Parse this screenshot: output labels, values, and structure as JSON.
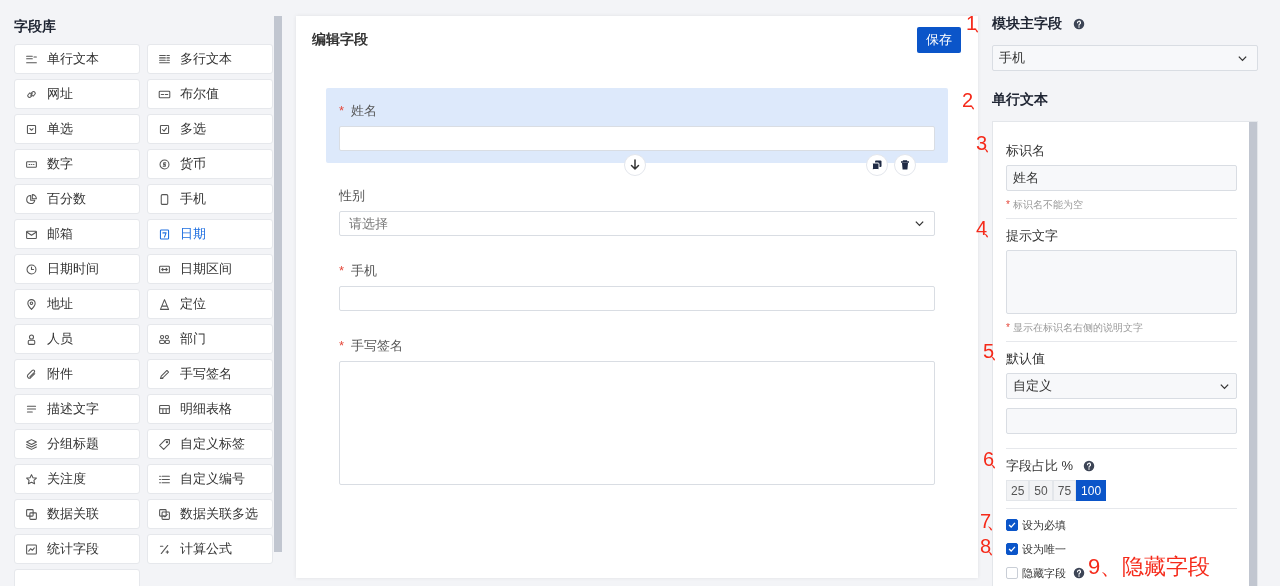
{
  "library": {
    "title": "字段库",
    "items": [
      {
        "label": "单行文本",
        "selected": false
      },
      {
        "label": "多行文本",
        "selected": false
      },
      {
        "label": "网址",
        "selected": false
      },
      {
        "label": "布尔值",
        "selected": false
      },
      {
        "label": "单选",
        "selected": false
      },
      {
        "label": "多选",
        "selected": false
      },
      {
        "label": "数字",
        "selected": false
      },
      {
        "label": "货币",
        "selected": false
      },
      {
        "label": "百分数",
        "selected": false
      },
      {
        "label": "手机",
        "selected": false
      },
      {
        "label": "邮箱",
        "selected": false
      },
      {
        "label": "日期",
        "selected": true
      },
      {
        "label": "日期时间",
        "selected": false
      },
      {
        "label": "日期区间",
        "selected": false
      },
      {
        "label": "地址",
        "selected": false
      },
      {
        "label": "定位",
        "selected": false
      },
      {
        "label": "人员",
        "selected": false
      },
      {
        "label": "部门",
        "selected": false
      },
      {
        "label": "附件",
        "selected": false
      },
      {
        "label": "手写签名",
        "selected": false
      },
      {
        "label": "描述文字",
        "selected": false
      },
      {
        "label": "明细表格",
        "selected": false
      },
      {
        "label": "分组标题",
        "selected": false
      },
      {
        "label": "自定义标签",
        "selected": false
      },
      {
        "label": "关注度",
        "selected": false
      },
      {
        "label": "自定义编号",
        "selected": false
      },
      {
        "label": "数据关联",
        "selected": false
      },
      {
        "label": "数据关联多选",
        "selected": false
      },
      {
        "label": "统计字段",
        "selected": false
      },
      {
        "label": "计算公式",
        "selected": false
      }
    ]
  },
  "editor": {
    "title": "编辑字段",
    "save_button": "保存",
    "fields": [
      {
        "kind": "input",
        "label": "姓名",
        "required_mark": "*",
        "selected": true
      },
      {
        "kind": "select",
        "label": "性别",
        "placeholder": "请选择",
        "selected": false
      },
      {
        "kind": "input",
        "label": "手机",
        "required_mark": "*",
        "selected": false
      },
      {
        "kind": "textarea",
        "label": "手写签名",
        "required_mark": "*",
        "selected": false
      }
    ]
  },
  "settings": {
    "main_field": {
      "label": "模块主字段",
      "help": true,
      "value": "手机"
    },
    "section_title": "单行文本",
    "name": {
      "label": "标识名",
      "value": "姓名",
      "hint_mark": "*",
      "hint": "标识名不能为空"
    },
    "tip": {
      "label": "提示文字",
      "hint_mark": "*",
      "hint": "显示在标识名右侧的说明文字"
    },
    "default": {
      "label": "默认值",
      "value": "自定义"
    },
    "width": {
      "label": "字段占比 %",
      "help": true,
      "options": [
        {
          "label": "25",
          "selected": false
        },
        {
          "label": "50",
          "selected": false
        },
        {
          "label": "75",
          "selected": false
        },
        {
          "label": "100",
          "selected": true
        }
      ]
    },
    "checks": [
      {
        "label": "设为必填",
        "checked": true,
        "help": false
      },
      {
        "label": "设为唯一",
        "checked": true,
        "help": false
      },
      {
        "label": "隐藏字段",
        "checked": false,
        "help": true
      }
    ]
  },
  "annotations": [
    "1、",
    "2、",
    "3、",
    "4、",
    "5、",
    "6、",
    "7、",
    "8、",
    "9、隐藏字段"
  ]
}
